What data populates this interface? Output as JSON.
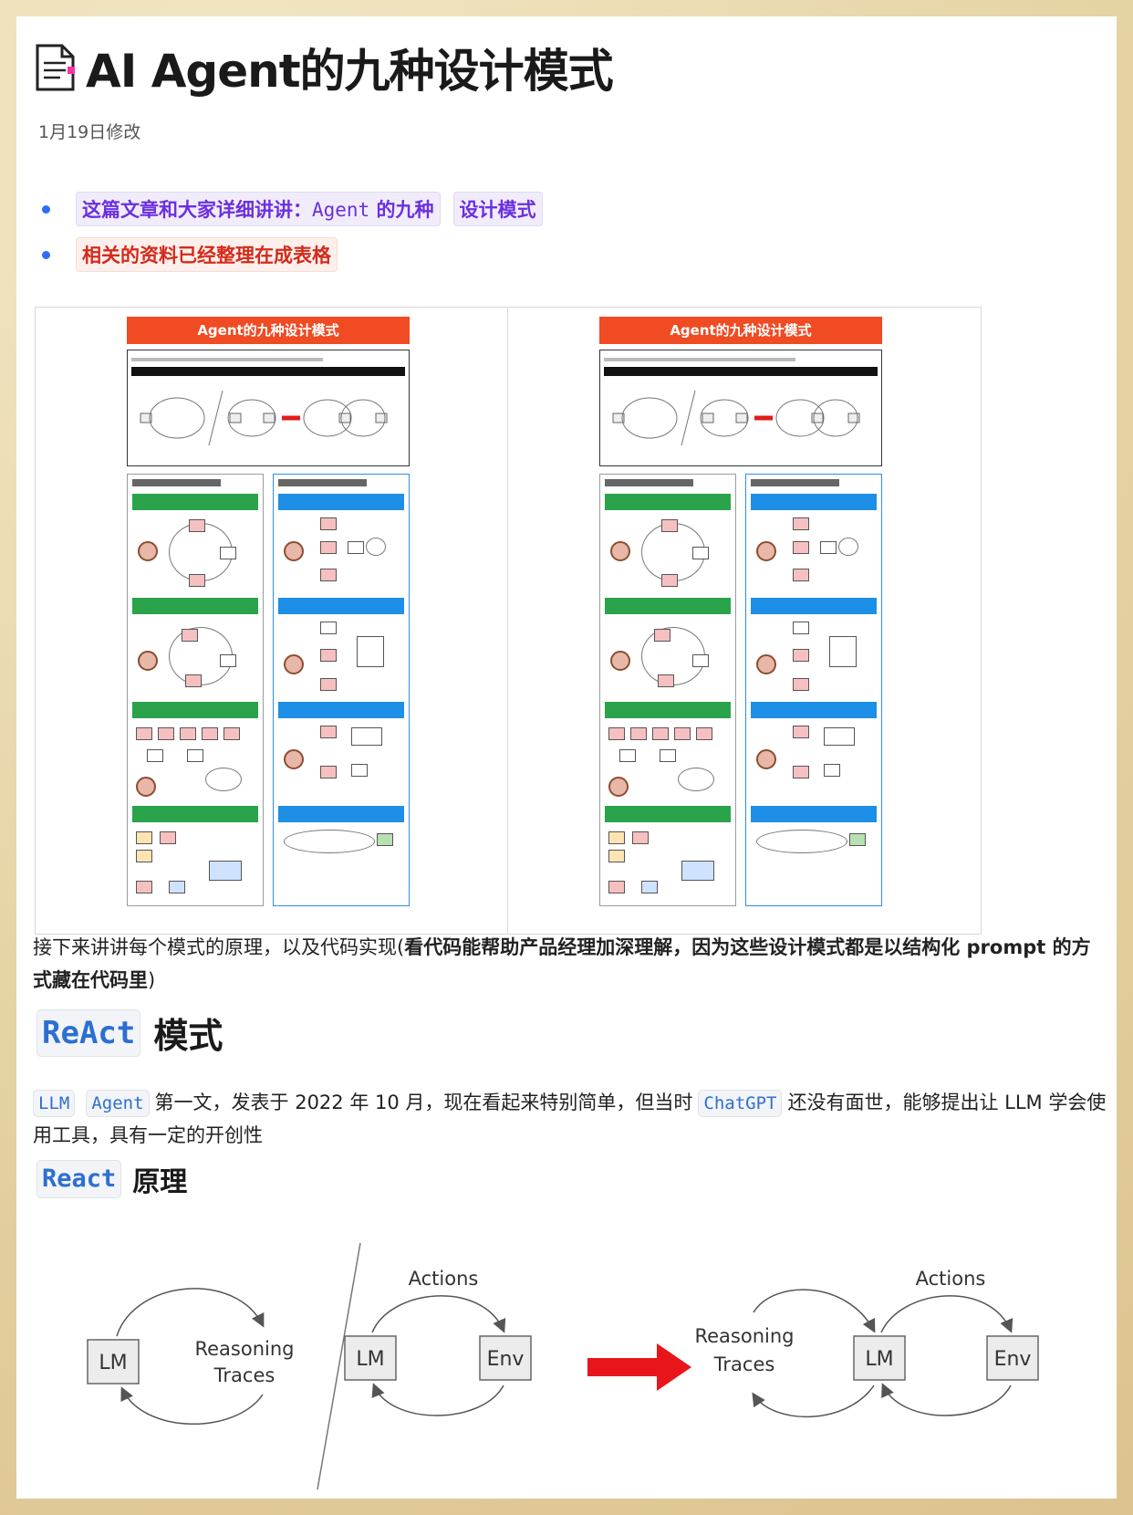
{
  "doc": {
    "title": "AI Agent的九种设计模式",
    "modified": "1月19日修改"
  },
  "bullets": {
    "b1_part1": "这篇文章和大家详细讲讲：",
    "b1_code": "Agent",
    "b1_part2": "的九种",
    "b1_chip2": "设计模式",
    "b2": "相关的资料已经整理在成表格"
  },
  "figure": {
    "poster_title": "Agent的九种设计模式"
  },
  "intro": {
    "plain": "接下来讲讲每个模式的原理，以及代码实现(",
    "bold": "看代码能帮助产品经理加深理解，因为这些设计模式都是以结构化 prompt 的方式藏在代码里",
    "end": ")"
  },
  "react_section": {
    "heading_code": "ReAct",
    "heading_text": "模式",
    "chip_llm": "LLM",
    "chip_agent": "Agent",
    "text1": "第一文，发表于 2022 年 10 月，现在看起来特别简单，但当时",
    "chip_chatgpt": "ChatGPT",
    "text2": "还没有面世，能够提出让 LLM 学会使用工具，具有一定的开创性",
    "sub_code": "React",
    "sub_text": "原理"
  },
  "diagram": {
    "lm": "LM",
    "env": "Env",
    "actions": "Actions",
    "reasoning": "Reasoning",
    "traces": "Traces",
    "arrow_color": "#e8161b"
  }
}
